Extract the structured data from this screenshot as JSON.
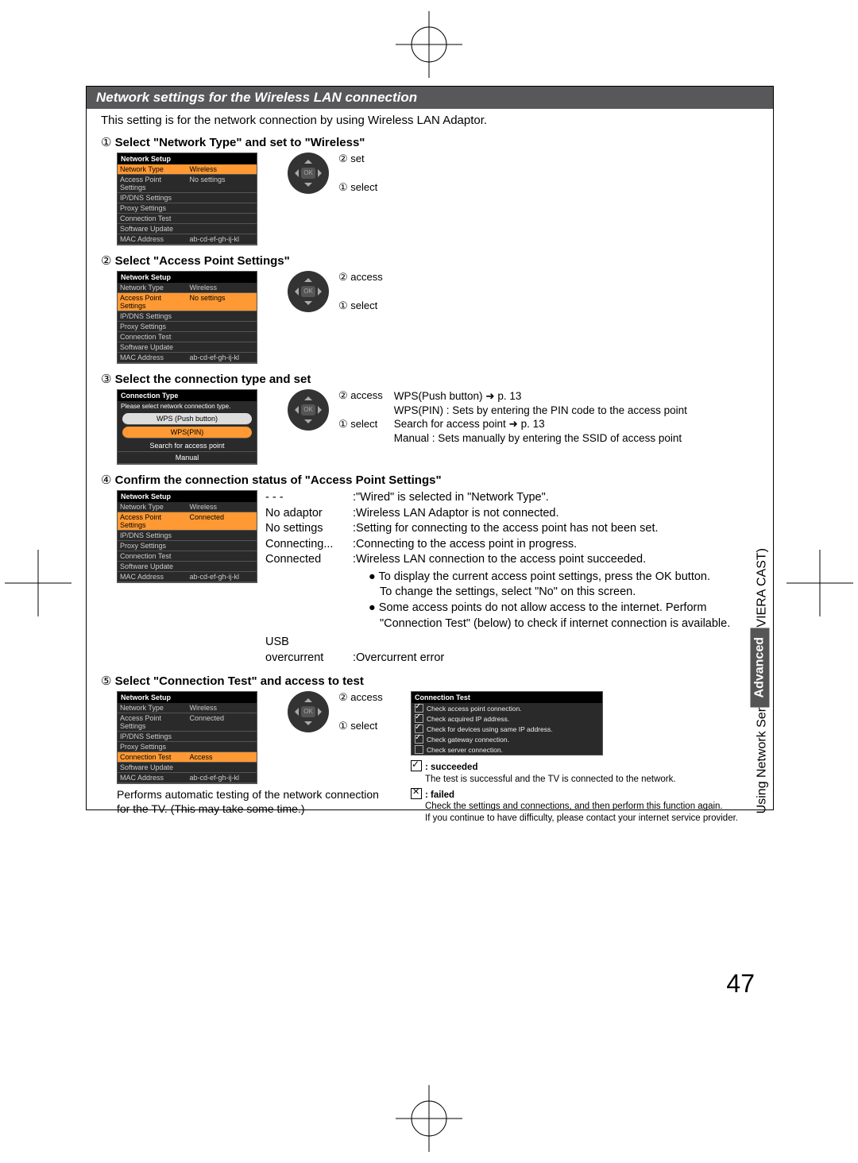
{
  "page_number": "47",
  "side_tab": {
    "category": "Advanced",
    "section": "Using Network Services (DLNA / VIERA CAST)"
  },
  "header": "Network settings for the Wireless LAN connection",
  "intro": "This setting is for the network connection by using Wireless LAN Adaptor.",
  "step1": {
    "num": "①",
    "title": "Select \"Network Type\" and set to \"Wireless\"",
    "menu_title": "Network Setup",
    "rows": [
      {
        "label": "Network Type",
        "value": "Wireless",
        "hl": true
      },
      {
        "label": "Access Point Settings",
        "value": "No settings"
      },
      {
        "label": "IP/DNS Settings",
        "value": ""
      },
      {
        "label": "Proxy Settings",
        "value": ""
      },
      {
        "label": "Connection Test",
        "value": ""
      },
      {
        "label": "Software Update",
        "value": ""
      },
      {
        "label": "MAC Address",
        "value": "ab-cd-ef-gh-ij-kl"
      }
    ],
    "dpad_top": "② set",
    "dpad_bottom": "① select"
  },
  "step2": {
    "num": "②",
    "title": "Select \"Access Point Settings\"",
    "menu_title": "Network Setup",
    "rows": [
      {
        "label": "Network Type",
        "value": "Wireless"
      },
      {
        "label": "Access Point Settings",
        "value": "No settings",
        "hl": true
      },
      {
        "label": "IP/DNS Settings",
        "value": ""
      },
      {
        "label": "Proxy Settings",
        "value": ""
      },
      {
        "label": "Connection Test",
        "value": ""
      },
      {
        "label": "Software Update",
        "value": ""
      },
      {
        "label": "MAC Address",
        "value": "ab-cd-ef-gh-ij-kl"
      }
    ],
    "dpad_top": "② access",
    "dpad_bottom": "① select"
  },
  "step3": {
    "num": "③",
    "title": "Select the connection type and set",
    "box_title": "Connection Type",
    "box_subtitle": "Please select network connection type.",
    "options": [
      {
        "text": "WPS (Push button)",
        "style": "light"
      },
      {
        "text": "WPS(PIN)",
        "style": "hl"
      },
      {
        "text": "Search for access point",
        "style": ""
      },
      {
        "text": "Manual",
        "style": ""
      }
    ],
    "dpad_top": "② access",
    "dpad_bottom": "① select",
    "desc": [
      "WPS(Push button) ➜ p. 13",
      "WPS(PIN)  : Sets by entering the PIN code to the access point",
      "Search for access point ➜ p. 13",
      "Manual       : Sets manually by entering the SSID of access point"
    ]
  },
  "step4": {
    "num": "④",
    "title": "Confirm the connection status of \"Access Point Settings\"",
    "menu_title": "Network Setup",
    "rows": [
      {
        "label": "Network Type",
        "value": "Wireless"
      },
      {
        "label": "Access Point Settings",
        "value": "Connected",
        "hl": true
      },
      {
        "label": "IP/DNS Settings",
        "value": ""
      },
      {
        "label": "Proxy Settings",
        "value": ""
      },
      {
        "label": "Connection Test",
        "value": ""
      },
      {
        "label": "Software Update",
        "value": ""
      },
      {
        "label": "MAC Address",
        "value": "ab-cd-ef-gh-ij-kl"
      }
    ],
    "statuses": [
      {
        "label": "- - -",
        "text": ":\"Wired\" is selected in \"Network Type\"."
      },
      {
        "label": "No adaptor",
        "text": ":Wireless LAN Adaptor is not connected."
      },
      {
        "label": "No settings",
        "text": ":Setting for connecting to the access point has not been set."
      },
      {
        "label": "Connecting...",
        "text": ":Connecting to the access point in progress."
      },
      {
        "label": "Connected",
        "text": ":Wireless LAN connection to the access point succeeded."
      }
    ],
    "bullets": [
      "To display the current access point settings, press the OK button.\nTo change the settings, select \"No\" on this screen.",
      "Some access points do not allow access to the internet. Perform \"Connection Test\" (below) to check if internet connection is available."
    ],
    "usb_label": "USB",
    "usb_row": {
      "label": "overcurrent",
      "text": ":Overcurrent error"
    }
  },
  "step5": {
    "num": "⑤",
    "title": "Select \"Connection Test\" and access to test",
    "menu_title": "Network Setup",
    "rows": [
      {
        "label": "Network Type",
        "value": "Wireless"
      },
      {
        "label": "Access Point Settings",
        "value": "Connected"
      },
      {
        "label": "IP/DNS Settings",
        "value": ""
      },
      {
        "label": "Proxy Settings",
        "value": ""
      },
      {
        "label": "Connection Test",
        "value": "Access",
        "hl": true
      },
      {
        "label": "Software Update",
        "value": ""
      },
      {
        "label": "MAC Address",
        "value": "ab-cd-ef-gh-ij-kl"
      }
    ],
    "dpad_top": "② access",
    "dpad_bottom": "① select",
    "test_title": "Connection Test",
    "tests": [
      {
        "ok": true,
        "text": "Check access point connection."
      },
      {
        "ok": true,
        "text": "Check acquired IP address."
      },
      {
        "ok": true,
        "text": "Check for devices using same IP address."
      },
      {
        "ok": true,
        "text": "Check gateway connection."
      },
      {
        "ok": false,
        "text": "Check server connection."
      }
    ],
    "perform_text": "Performs automatic testing of the network connection for the TV. (This may take some time.)",
    "succeeded_label": ": succeeded",
    "succeeded_text": "The test is successful and the TV is connected to the network.",
    "failed_label": ": failed",
    "failed_text": "Check the settings and connections, and then perform this function again.\nIf you continue to have difficulty, please contact your internet service provider."
  }
}
